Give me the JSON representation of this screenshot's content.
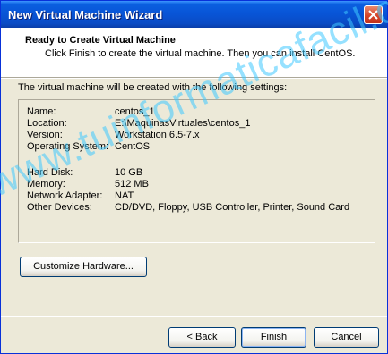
{
  "window": {
    "title": "New Virtual Machine Wizard",
    "close_icon": "close-icon"
  },
  "header": {
    "title": "Ready to Create Virtual Machine",
    "subtitle": "Click Finish to create the virtual machine. Then you can install CentOS."
  },
  "intro": "The virtual machine will be created with the following settings:",
  "settings": [
    {
      "key": "Name:",
      "value": "centos_1"
    },
    {
      "key": "Location:",
      "value": "E:\\MaquinasVirtuales\\centos_1"
    },
    {
      "key": "Version:",
      "value": "Workstation 6.5-7.x"
    },
    {
      "key": "Operating System:",
      "value": "CentOS"
    },
    {
      "key": "Hard Disk:",
      "value": "10 GB"
    },
    {
      "key": "Memory:",
      "value": "512 MB"
    },
    {
      "key": "Network Adapter:",
      "value": "NAT"
    },
    {
      "key": "Other Devices:",
      "value": "CD/DVD, Floppy, USB Controller, Printer, Sound Card"
    }
  ],
  "buttons": {
    "customize": "Customize Hardware...",
    "back": "< Back",
    "finish": "Finish",
    "cancel": "Cancel"
  },
  "watermark": "www.tuinformaticafacil.com"
}
